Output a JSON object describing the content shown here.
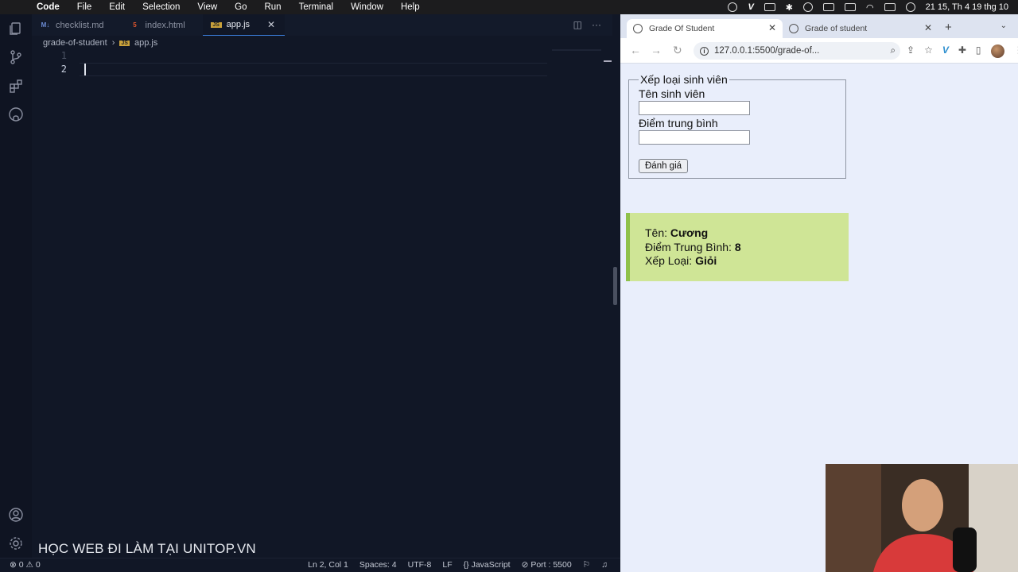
{
  "menubar": {
    "app": "Code",
    "items": [
      "File",
      "Edit",
      "Selection",
      "View",
      "Go",
      "Run",
      "Terminal",
      "Window",
      "Help"
    ],
    "clock": "21 15, Th 4 19 thg 10"
  },
  "editor": {
    "tabs": [
      {
        "label": "checklist.md",
        "badge": "M↓"
      },
      {
        "label": "index.html",
        "badge": "5"
      },
      {
        "label": "app.js",
        "badge": "JS"
      }
    ],
    "breadcrumb": {
      "folder": "grade-of-student",
      "file": "app.js"
    },
    "lines": [
      "1",
      "2"
    ],
    "watermark": "HỌC WEB ĐI LÀM TẠI UNITOP.VN",
    "status": {
      "errors": "0",
      "warnings": "0",
      "position": "Ln 2, Col 1",
      "spaces": "Spaces: 4",
      "encoding": "UTF-8",
      "eol": "LF",
      "language": "JavaScript",
      "port": "Port : 5500"
    }
  },
  "browser": {
    "tabs": [
      {
        "title": "Grade Of Student"
      },
      {
        "title": "Grade of student"
      }
    ],
    "url": "127.0.0.1:5500/grade-of...",
    "form": {
      "legend": "Xếp loại sinh viên",
      "name_label": "Tên sinh viên",
      "name_value": "",
      "score_label": "Điểm trung bình",
      "score_value": "",
      "submit": "Đánh giá"
    },
    "result": {
      "name_label": "Tên: ",
      "name_value": "Cương",
      "score_label": "Điểm Trung Bình: ",
      "score_value": "8",
      "grade_label": "Xếp Loại: ",
      "grade_value": "Giỏi"
    }
  }
}
